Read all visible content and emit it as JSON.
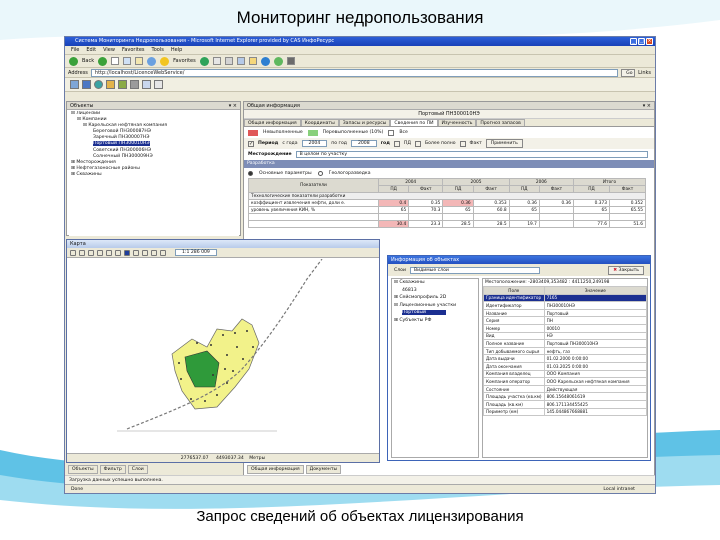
{
  "slide": {
    "title": "Мониторинг недропользования",
    "caption": "Запрос сведений об объектах лицензирования"
  },
  "browser": {
    "window_title": "Система Мониторинга Недропользования - Microsoft Internet Explorer provided by CAS ИнфоРесурс",
    "menu": [
      "File",
      "Edit",
      "View",
      "Favorites",
      "Tools",
      "Help"
    ],
    "toolbar": {
      "back": "Back",
      "favorites": "Favorites"
    },
    "address_label": "Address",
    "address": "http://localhost/LicenceWebService/",
    "go": "Go",
    "links": "Links",
    "status_left": "Done",
    "status_right": "Local intranet",
    "status_message": "Загрузка данных успешно выполнена."
  },
  "objects_panel": {
    "title": "Объекты",
    "tree": [
      "Лицензии",
      "Компании",
      "Карельская нефтяная компания",
      "Береговой ПН300087НЭ",
      "Заречный ПН300007НЭ",
      "Портовый ПН300010НЭ",
      "Советский ПН300006НЭ",
      "Солнечный ПН300009НЭ",
      "Месторождения",
      "Нефтегазоносные районы",
      "Скважины"
    ],
    "selected_index": 5
  },
  "info_panel": {
    "title": "Общая информация",
    "header_value": "Портовый ПН300010НЭ",
    "tabs": [
      "Общая информация",
      "Координаты",
      "Запасы и ресурсы",
      "Сведения по ПИ",
      "Изученность",
      "Прогноз запасов"
    ],
    "active_tab": 3,
    "legend": [
      "Невыполненные",
      "Перевыполненные (10%)",
      "Все"
    ],
    "period_label": "Период",
    "period_from_label": "с года",
    "period_from": "2004",
    "period_to_label": "по год",
    "period_to": "2008",
    "year_label": "год",
    "check_pd": "ПД",
    "check_bez": "Более полно",
    "check_fact": "Факт",
    "apply_btn": "Применить",
    "field_label": "Месторождение",
    "field_value": "В целом по участку",
    "section_label": "Разработка",
    "radio_main": "Основные параметры",
    "radio_geo": "Геологоразведка",
    "table": {
      "indicator_header": "Показатели",
      "years": [
        "2004",
        "2005",
        "2006",
        "Итого"
      ],
      "sub_headers": [
        "ПД",
        "Факт"
      ],
      "group_row": "Технологические показатели разработки",
      "rows": [
        {
          "label": "коэффициент извлечения нефти, доли е.",
          "values": [
            "0.4",
            "0.35",
            "0.36",
            "0.353",
            "0.36",
            "0.36",
            "0.373",
            "0.352"
          ],
          "red": [
            0,
            2
          ]
        },
        {
          "label": "уровень увеличения КИН, %",
          "values": [
            "65",
            "70.3",
            "65",
            "60.8",
            "65",
            "",
            "65",
            "65.55"
          ],
          "red": []
        },
        {
          "label": "",
          "values": [
            "",
            "",
            "",
            "",
            "",
            "",
            "",
            ""
          ],
          "red": []
        },
        {
          "label": "",
          "values": [
            "30.4",
            "23.3",
            "28.5",
            "28.5",
            "19.7",
            "",
            "77.6",
            "51.6"
          ],
          "red": [
            0
          ]
        }
      ]
    }
  },
  "map_window": {
    "title": "Карта",
    "scale": "1:1 286 009",
    "coords": "2776537.07",
    "coords2": "4493037.34",
    "units": "Метры"
  },
  "object_info": {
    "title": "Информация об объектах",
    "layers_label": "Слои",
    "layers_value": "Видимые слои",
    "close_btn": "Закрыть",
    "location_label": "Местоположение",
    "location_value": "-2803409,353482 : 4411250,249198",
    "tree": [
      "Скважины",
      "46813",
      "Сейсмопрофиль 2D",
      "Лицензионные участки",
      "Портовый",
      "Субъекты РФ"
    ],
    "tree_selected": 4,
    "table_headers": [
      "Поле",
      "Значение"
    ],
    "rows": [
      [
        "Граница идентификатор",
        "7165"
      ],
      [
        "Идентификатор",
        "ПН300010НЭ"
      ],
      [
        "Название",
        "Портовый"
      ],
      [
        "Серия",
        "ПН"
      ],
      [
        "Номер",
        "00010"
      ],
      [
        "Вид",
        "НЭ"
      ],
      [
        "Полное название",
        "Портовый ПН300010НЭ"
      ],
      [
        "Тип добываемого сырья",
        "нефть, газ"
      ],
      [
        "Дата выдачи",
        "01.02.2000 0:00:00"
      ],
      [
        "Дата окончания",
        "01.03.2025 0:00:00"
      ],
      [
        "Компания владелец",
        "ООО Компания"
      ],
      [
        "Компания оператор",
        "ООО Карельская нефтяная компания"
      ],
      [
        "Состояние",
        "Действующая"
      ],
      [
        "Площадь участка (кв.км)",
        "806.15648061619"
      ],
      [
        "Площадь (кв.км)",
        "806.171134455425"
      ],
      [
        "Периметр (км)",
        "145.044867668881"
      ]
    ],
    "highlight_row": 0
  },
  "bottom_tabs_left": [
    "Объекты",
    "Фильтр",
    "Слои"
  ],
  "bottom_tabs_right": [
    "Общая информация",
    "Документы"
  ],
  "colors": {
    "map_yellow": "#f2f28a",
    "map_green": "#2f9a3a",
    "selection": "#1b2f91",
    "title_bar": "#2350c0"
  }
}
